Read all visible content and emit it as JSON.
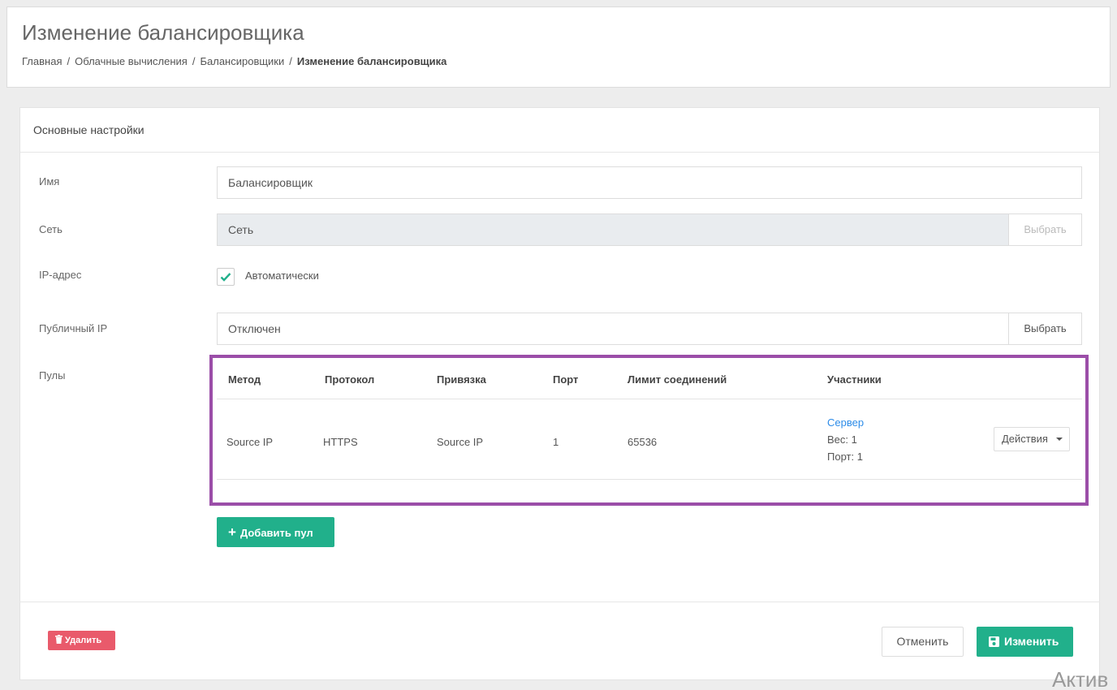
{
  "header": {
    "title": "Изменение балансировщика",
    "breadcrumb": [
      "Главная",
      "Облачные вычисления",
      "Балансировщики",
      "Изменение балансировщика"
    ],
    "separator": "/"
  },
  "card": {
    "title": "Основные настройки"
  },
  "form": {
    "name": {
      "label": "Имя",
      "value": "Балансировщик"
    },
    "network": {
      "label": "Сеть",
      "value": "Сеть",
      "button": "Выбрать"
    },
    "ip": {
      "label": "IP-адрес",
      "checkbox_label": "Автоматически",
      "checked": true
    },
    "public_ip": {
      "label": "Публичный IP",
      "value": "Отключен",
      "button": "Выбрать"
    },
    "pools": {
      "label": "Пулы"
    }
  },
  "pools_table": {
    "columns": [
      "Метод",
      "Протокол",
      "Привязка",
      "Порт",
      "Лимит соединений",
      "Участники"
    ],
    "rows": [
      {
        "method": "Source IP",
        "protocol": "HTTPS",
        "binding": "Source IP",
        "port": "1",
        "limit": "65536",
        "member_name": "Сервер",
        "member_weight": "Вес: 1",
        "member_port": "Порт: 1",
        "actions": "Действия"
      }
    ]
  },
  "buttons": {
    "add_pool": "Добавить пул",
    "delete": "Удалить",
    "cancel": "Отменить",
    "submit": "Изменить"
  },
  "watermark": "Актив",
  "colors": {
    "accent": "#21b08b",
    "danger": "#e95a6b",
    "highlight": "#9b4ea8",
    "link": "#2d8ce8"
  }
}
